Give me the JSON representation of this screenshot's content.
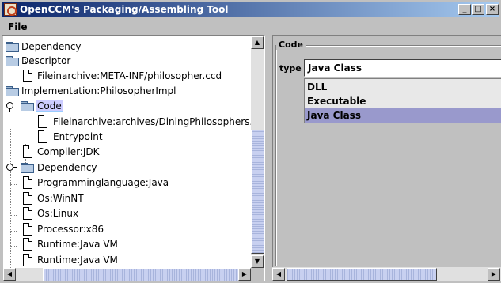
{
  "window": {
    "title": "OpenCCM's Packaging/Assembling Tool",
    "buttons": {
      "minimize": "_",
      "maximize": "□",
      "close": "×"
    }
  },
  "menubar": {
    "items": [
      {
        "label": "File"
      }
    ]
  },
  "tree": {
    "nodes": [
      {
        "label": "Dependency",
        "icon": "folder-icon",
        "depth": 0
      },
      {
        "label": "Descriptor",
        "icon": "folder-icon",
        "depth": 0
      },
      {
        "label": "Fileinarchive:META-INF/philosopher.ccd",
        "icon": "file-icon",
        "depth": 1
      },
      {
        "label": "Implementation:PhilosopherImpl",
        "icon": "folder-icon",
        "depth": 0
      },
      {
        "label": "Code",
        "icon": "folder-icon",
        "depth": 1,
        "expanded": true,
        "selected": true
      },
      {
        "label": "Fileinarchive:archives/DiningPhilosophers.jar",
        "icon": "file-icon",
        "depth": 2
      },
      {
        "label": "Entrypoint",
        "icon": "file-icon",
        "depth": 2
      },
      {
        "label": "Compiler:JDK",
        "icon": "file-icon",
        "depth": 1
      },
      {
        "label": "Dependency",
        "icon": "folder-icon",
        "depth": 1,
        "expanded": false
      },
      {
        "label": "Programminglanguage:Java",
        "icon": "file-icon",
        "depth": 1
      },
      {
        "label": "Os:WinNT",
        "icon": "file-icon",
        "depth": 1
      },
      {
        "label": "Os:Linux",
        "icon": "file-icon",
        "depth": 1
      },
      {
        "label": "Processor:x86",
        "icon": "file-icon",
        "depth": 1
      },
      {
        "label": "Runtime:Java VM",
        "icon": "file-icon",
        "depth": 1
      },
      {
        "label": "Runtime:Java VM",
        "icon": "file-icon",
        "depth": 1
      }
    ]
  },
  "scrollbars": {
    "up": "▲",
    "down": "▼",
    "left": "◀",
    "right": "▶"
  },
  "code_panel": {
    "group_title": "Code",
    "type_label": "type :",
    "type_value": "Java Class",
    "options": [
      {
        "label": "DLL",
        "selected": false
      },
      {
        "label": "Executable",
        "selected": false
      },
      {
        "label": "Java Class",
        "selected": true
      }
    ]
  },
  "colors": {
    "titlebar_start": "#0a246a",
    "titlebar_end": "#a6caf0",
    "selection": "#ccccff",
    "dropdown_selected": "#9999cc",
    "face": "#c0c0c0"
  }
}
